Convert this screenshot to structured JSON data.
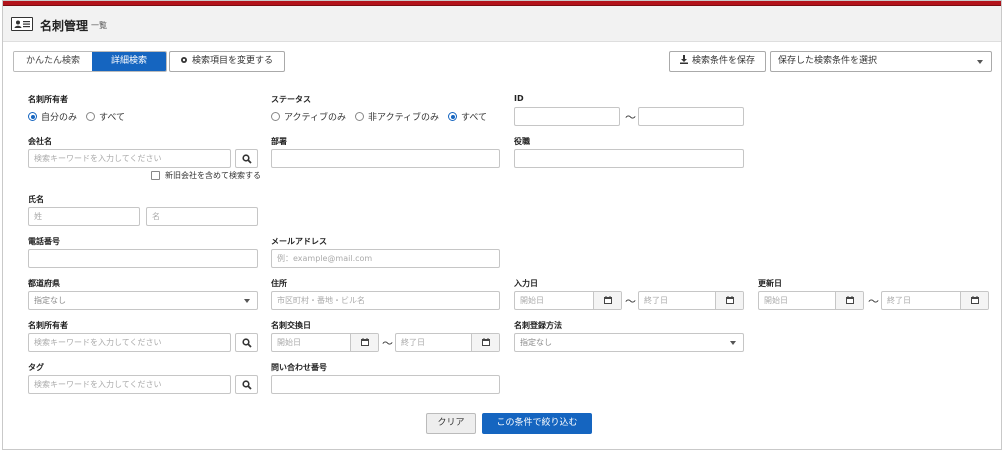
{
  "page": {
    "title": "名刺管理",
    "subtitle": "一覧"
  },
  "tabs": [
    {
      "label": "かんたん検索"
    },
    {
      "label": "詳細検索"
    }
  ],
  "toolbar": {
    "change_items": "検索項目を変更する",
    "save_conditions": "検索条件を保存",
    "saved_select": "保存した検索条件を選択"
  },
  "fields": {
    "owner_scope": {
      "label": "名刺所有者",
      "options": [
        "自分のみ",
        "すべて"
      ],
      "selected": "自分のみ"
    },
    "status": {
      "label": "ステータス",
      "options": [
        "アクティブのみ",
        "非アクティブのみ",
        "すべて"
      ],
      "selected": "すべて"
    },
    "id": {
      "label": "ID",
      "separator": "〜"
    },
    "company": {
      "label": "会社名",
      "placeholder": "検索キーワードを入力してください",
      "checkbox": "新旧会社を含めて検索する"
    },
    "department": {
      "label": "部署"
    },
    "position": {
      "label": "役職"
    },
    "name": {
      "label": "氏名",
      "last_placeholder": "姓",
      "first_placeholder": "名"
    },
    "phone": {
      "label": "電話番号"
    },
    "email": {
      "label": "メールアドレス",
      "placeholder": "例：example@mail.com"
    },
    "prefecture": {
      "label": "都道府県",
      "value": "指定なし"
    },
    "address": {
      "label": "住所",
      "placeholder": "市区町村・番地・ビル名"
    },
    "entry_date": {
      "label": "入力日",
      "start": "開始日",
      "end": "終了日",
      "separator": "〜"
    },
    "updated_date": {
      "label": "更新日",
      "start": "開始日",
      "end": "終了日",
      "separator": "〜"
    },
    "card_owner": {
      "label": "名刺所有者",
      "placeholder": "検索キーワードを入力してください"
    },
    "exchange_date": {
      "label": "名刺交換日",
      "start": "開始日",
      "end": "終了日",
      "separator": "〜"
    },
    "registration_method": {
      "label": "名刺登録方法",
      "value": "指定なし"
    },
    "tag": {
      "label": "タグ",
      "placeholder": "検索キーワードを入力してください"
    },
    "inquiry_number": {
      "label": "問い合わせ番号"
    }
  },
  "actions": {
    "clear": "クリア",
    "apply": "この条件で絞り込む"
  },
  "colors": {
    "brand_bar": "#b3131b",
    "accent": "#1565c0"
  }
}
